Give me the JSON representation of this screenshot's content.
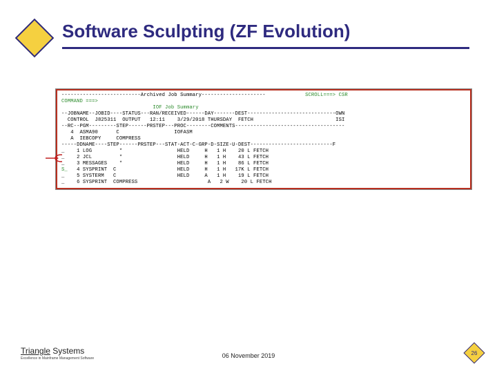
{
  "title": "Software Sculpting (ZF Evolution)",
  "terminal": {
    "line0": "--------------------------Archived Job Summary---------------------             <span class=\"green\">SCROLL===> CSR</span>",
    "line1": "<span class=\"green\">COMMAND ===></span>",
    "line2": "                              <span class=\"green\">IOF Job Summary</span>",
    "line3": "--JOBNAME--JOBID----STATUS---RAN/RECEIVED------DAY-------DEST-----------------------------OWN",
    "line4": "  CONTROL  J825311  OUTPUT   12:11    3/29/2018 THURSDAY  FETCH                           ISI",
    "line5": "--RC--PGM---------STEP------PRSTEP---PROC--------COMMENTS------------------------------------",
    "line6": "   4  ASMA90      C                  IOFASM",
    "line7": "   A  IEBCOPY     COMPRESS",
    "line8": "-----DDNAME----STEP------PRSTEP---STAT-ACT-C-GRP-D-SIZE-U-DEST---------------------------F",
    "line9": "_    1 LOG         *                  HELD     H   1 H    20 L FETCH",
    "line10": "_    2 JCL         *                  HELD     H   1 H    43 L FETCH",
    "line11": "_    3 MESSAGES    *                  HELD     H   1 H    86 L FETCH",
    "line12": "<span class=\"green\">S_</span>   4 SYSPRINT  C                    HELD     H   1 H   17K L FETCH",
    "line13": "_    5 SYSTERM   C                    HELD     A   1 H    19 L FETCH",
    "line14": "_    6 SYSPRINT  COMPRESS                       A   2 W    20 L FETCH"
  },
  "footer": {
    "logoTri": "Triangle",
    "logoSys": " Systems",
    "tagline": "Excellence in Mainframe Management Software",
    "date": "06 November 2019",
    "page": "26"
  }
}
